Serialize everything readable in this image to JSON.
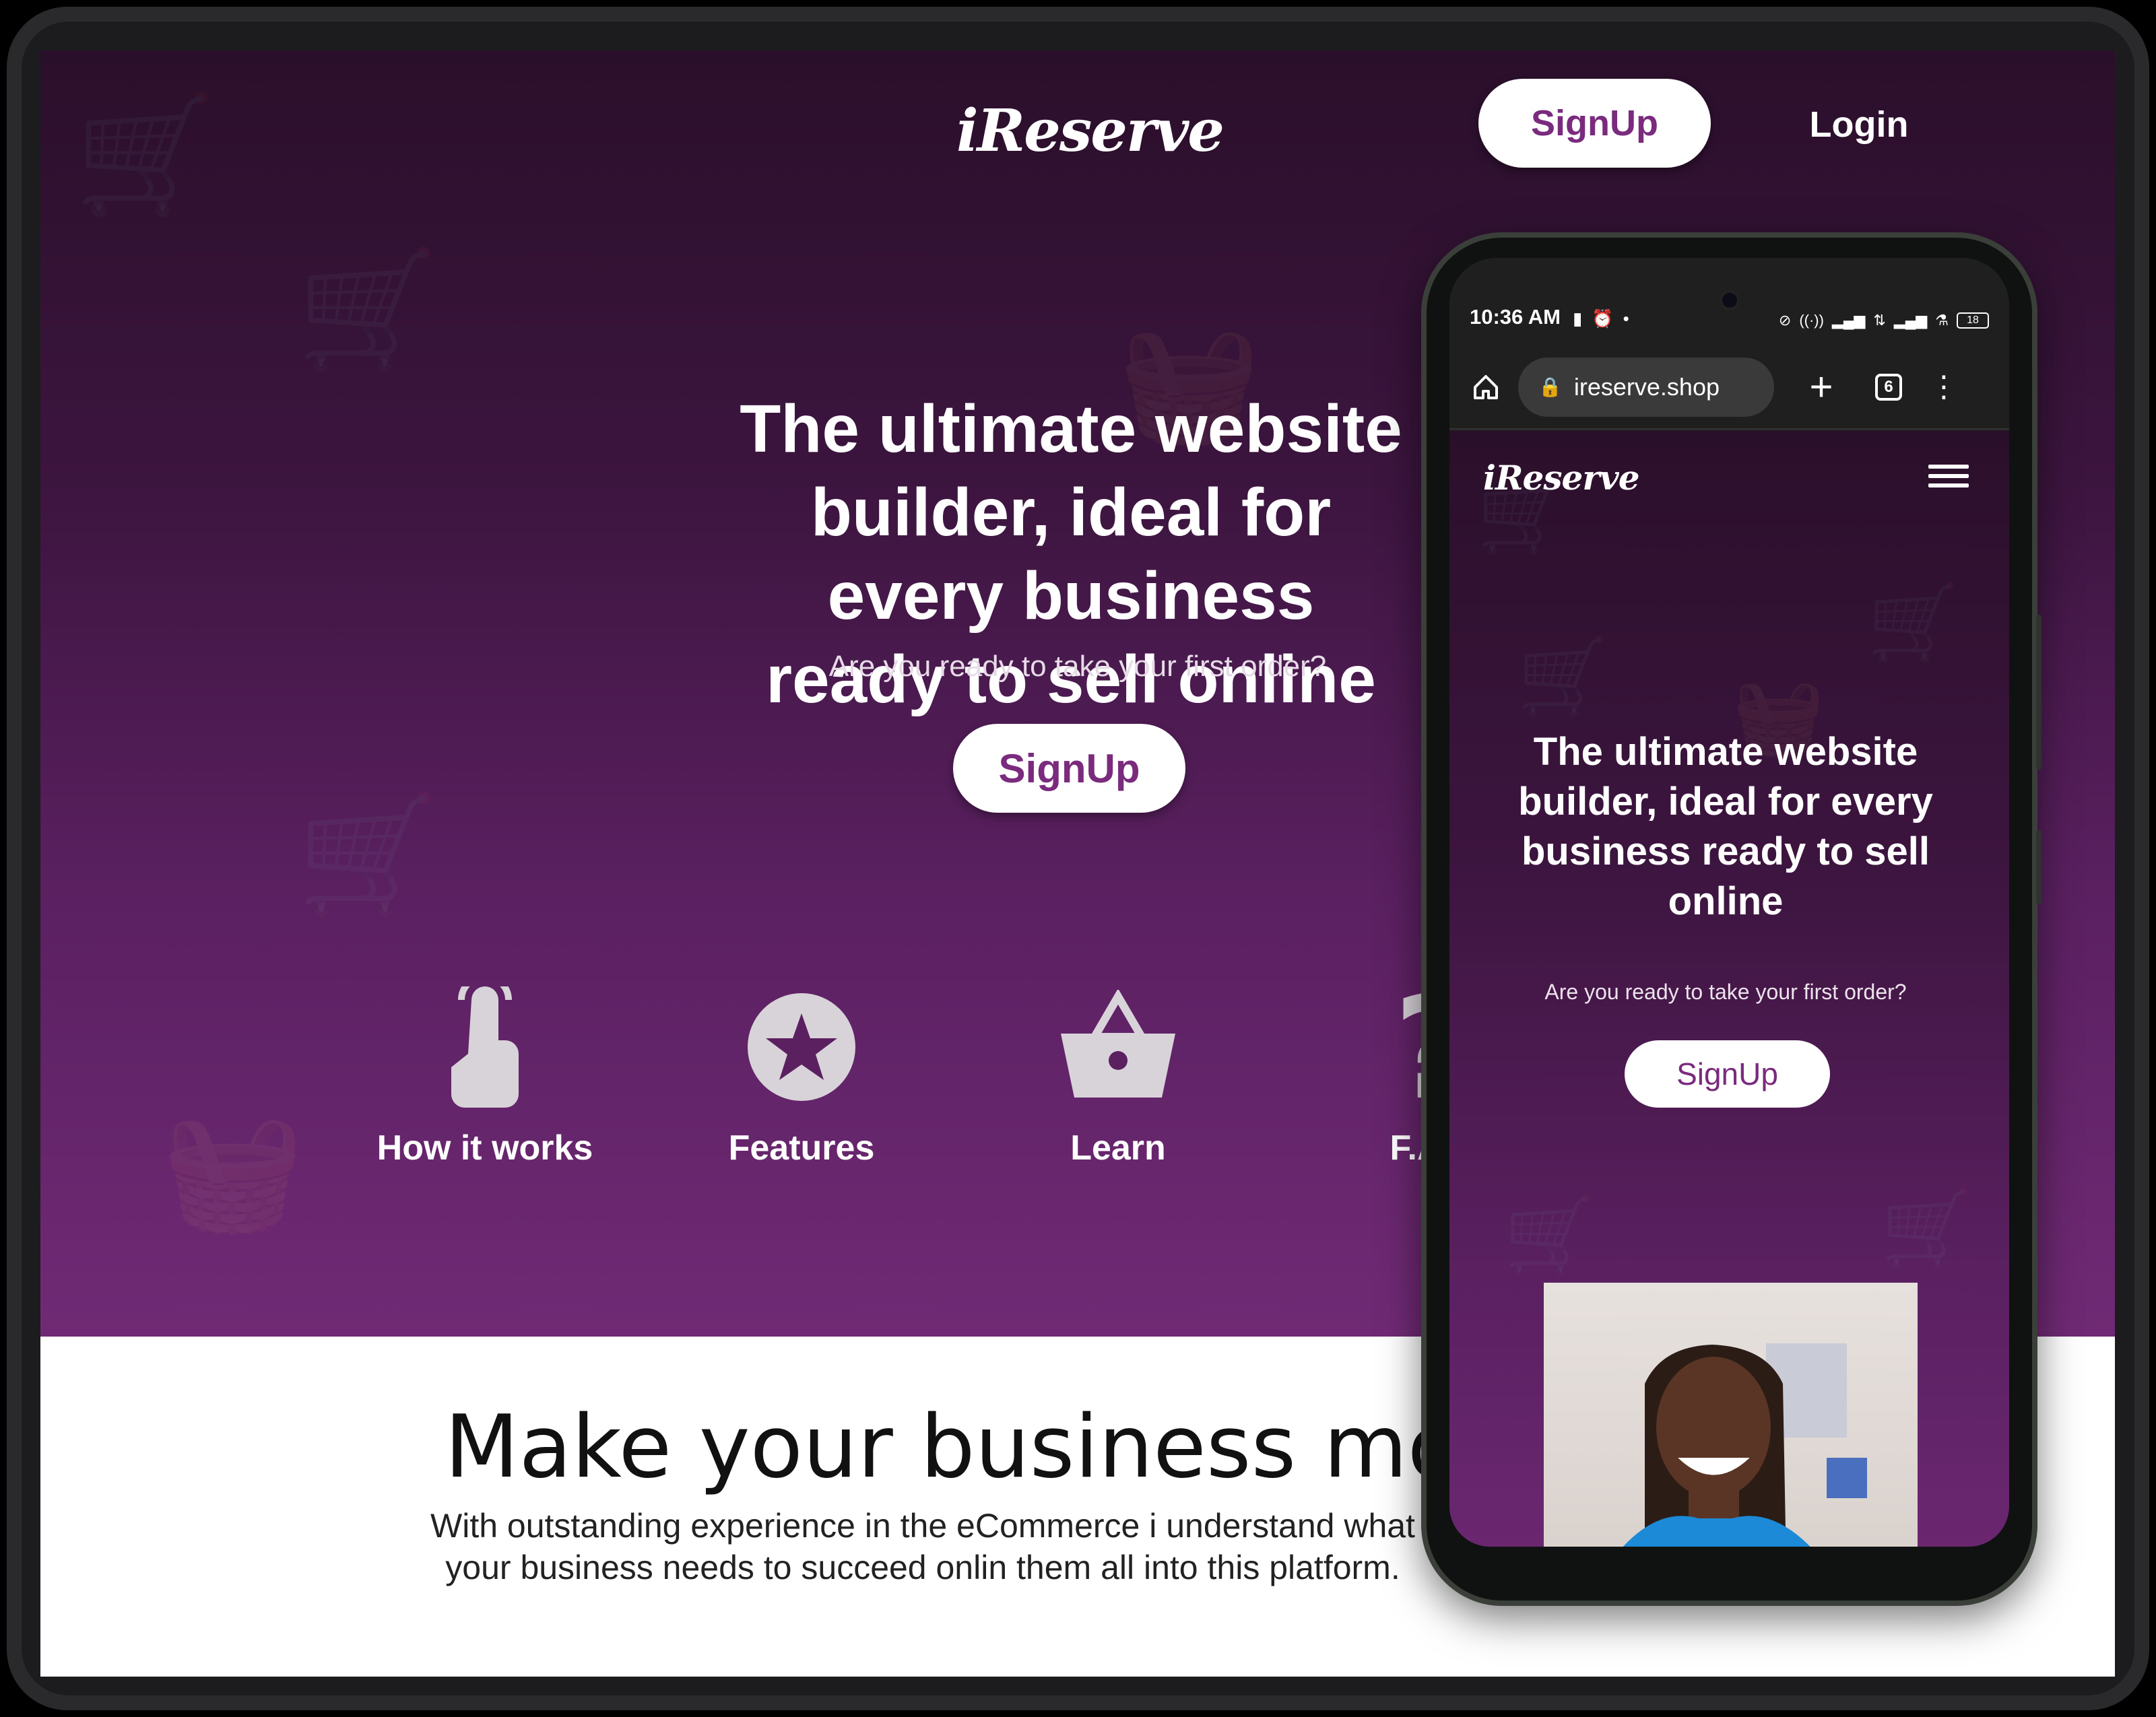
{
  "desktop": {
    "logo": "iReserve",
    "header": {
      "signup_label": "SignUp",
      "login_label": "Login"
    },
    "hero": {
      "headline": "The ultimate website builder, ideal for every business ready to sell online",
      "subheadline": "Are you ready to take your first order?",
      "signup_label": "SignUp"
    },
    "nav": [
      {
        "label": "How it works",
        "icon": "pointer-hand-icon"
      },
      {
        "label": "Features",
        "icon": "star-icon"
      },
      {
        "label": "Learn",
        "icon": "basket-icon"
      },
      {
        "label": "F.A.Q",
        "icon": "question-mark-icon"
      }
    ],
    "section": {
      "title": "Make your business more",
      "body": "With outstanding experience in the eCommerce i understand what your business needs to succeed onlin them all into this platform."
    }
  },
  "phone": {
    "status": {
      "time": "10:36 AM",
      "battery": "18"
    },
    "browser": {
      "url": "ireserve.shop",
      "tab_count": "6"
    },
    "page": {
      "logo": "iReserve",
      "headline": "The ultimate website builder, ideal for every business ready to sell online",
      "subheadline": "Are you ready to take your first order?",
      "signup_label": "SignUp"
    }
  },
  "colors": {
    "brand_purple": "#7a2b7e",
    "hero_dark": "#2a0f2a",
    "hero_light": "#702a75"
  }
}
